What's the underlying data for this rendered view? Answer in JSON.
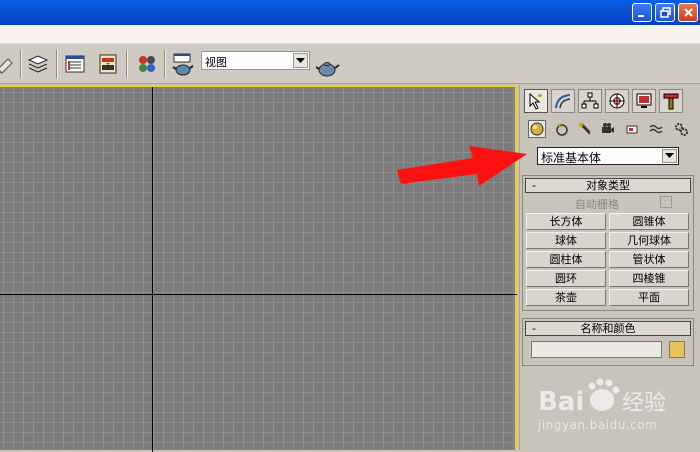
{
  "toolbar": {
    "view_combo": {
      "value": "视图"
    }
  },
  "command_panel": {
    "tabs": [
      {
        "icon": "create-cursor-icon",
        "active": true
      },
      {
        "icon": "modify-icon",
        "active": false
      },
      {
        "icon": "hierarchy-icon",
        "active": false
      },
      {
        "icon": "motion-icon",
        "active": false
      },
      {
        "icon": "display-icon",
        "active": false
      },
      {
        "icon": "utilities-hammer-icon",
        "active": false
      }
    ],
    "subtabs": [
      "geometry-icon",
      "shapes-icon",
      "lights-icon",
      "cameras-icon",
      "helpers-icon",
      "space-warps-icon",
      "systems-icon"
    ],
    "category": "标准基本体",
    "object_type": {
      "header": "对象类型",
      "collapse": "-",
      "autogrid_label": "自动栅格",
      "buttons": [
        [
          "长方体",
          "圆锥体"
        ],
        [
          "球体",
          "几何球体"
        ],
        [
          "圆柱体",
          "管状体"
        ],
        [
          "圆环",
          "四棱锥"
        ],
        [
          "茶壶",
          "平面"
        ]
      ]
    },
    "name_color": {
      "header": "名称和颜色",
      "collapse": "-",
      "name_value": "",
      "color": "#e6c45c"
    }
  },
  "annotation": {
    "arrow_color": "#ff0000"
  },
  "watermark": {
    "brand": "Bai  经验",
    "url": "jingyan.baidu.com"
  },
  "colors": {
    "viewport_border": "#f0d020",
    "titlebar": "#0854d8"
  }
}
